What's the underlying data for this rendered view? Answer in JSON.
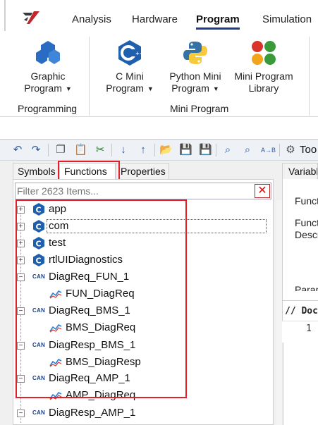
{
  "ribbon_tabs": [
    "Analysis",
    "Hardware",
    "Program",
    "Simulation"
  ],
  "active_tab": "Program",
  "ribbon": {
    "graphic_program": {
      "line1": "Graphic",
      "line2": "Program"
    },
    "c_mini_program": {
      "line1": "C Mini",
      "line2": "Program"
    },
    "python_mini_program": {
      "line1": "Python Mini",
      "line2": "Program"
    },
    "mini_program_library": {
      "line1": "Mini Program",
      "line2": "Library"
    },
    "group_programming": "Programming",
    "group_mini_program": "Mini Program"
  },
  "toolbar": {
    "tools_label": "Too"
  },
  "panel_tabs": [
    "Symbols",
    "Functions",
    "Properties"
  ],
  "active_panel_tab": "Functions",
  "filter": {
    "placeholder": "Filter 2623 Items..."
  },
  "tree": [
    {
      "label": "app",
      "kind": "c"
    },
    {
      "label": "com",
      "kind": "c"
    },
    {
      "label": "test",
      "kind": "c"
    },
    {
      "label": "rtlUIDiagnostics",
      "kind": "c"
    },
    {
      "label": "DiagReq_FUN_1",
      "kind": "can"
    },
    {
      "label": "FUN_DiagReq",
      "kind": "signal"
    },
    {
      "label": "DiagReq_BMS_1",
      "kind": "can"
    },
    {
      "label": "BMS_DiagReq",
      "kind": "signal"
    },
    {
      "label": "DiagResp_BMS_1",
      "kind": "can"
    },
    {
      "label": "BMS_DiagResp",
      "kind": "signal"
    },
    {
      "label": "DiagReq_AMP_1",
      "kind": "can"
    },
    {
      "label": "AMP_DiagReq",
      "kind": "signal"
    },
    {
      "label": "DiagResp_AMP_1",
      "kind": "can"
    }
  ],
  "right_panel": {
    "tab": "Variabl",
    "func1": "Functi",
    "func2": "Functi",
    "desc": "Descri",
    "param": "Param",
    "doc_header": "// Doc",
    "line_no": "1"
  },
  "can_label": "CAN"
}
